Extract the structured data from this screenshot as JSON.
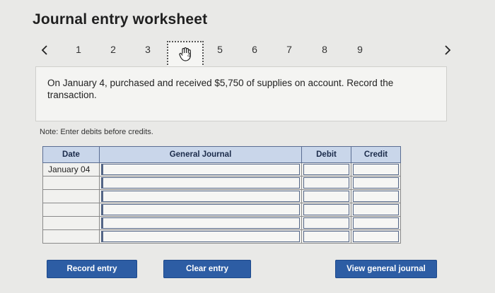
{
  "title": "Journal entry worksheet",
  "pager": {
    "prev_icon": "chevron-left",
    "next_icon": "chevron-right",
    "pages": [
      "1",
      "2",
      "3",
      "4",
      "5",
      "6",
      "7",
      "8",
      "9"
    ],
    "current_page": "4"
  },
  "question": "On January 4, purchased and received $5,750 of supplies on account. Record the transaction.",
  "note": "Note: Enter debits before credits.",
  "table": {
    "headers": {
      "date": "Date",
      "journal": "General Journal",
      "debit": "Debit",
      "credit": "Credit"
    },
    "rows": [
      {
        "date": "January 04",
        "account": "",
        "debit": "",
        "credit": ""
      },
      {
        "date": "",
        "account": "",
        "debit": "",
        "credit": ""
      },
      {
        "date": "",
        "account": "",
        "debit": "",
        "credit": ""
      },
      {
        "date": "",
        "account": "",
        "debit": "",
        "credit": ""
      },
      {
        "date": "",
        "account": "",
        "debit": "",
        "credit": ""
      },
      {
        "date": "",
        "account": "",
        "debit": "",
        "credit": ""
      }
    ]
  },
  "buttons": {
    "record": "Record entry",
    "clear": "Clear entry",
    "view": "View general journal"
  },
  "colors": {
    "background": "#e9e9e7",
    "header_fill": "#c9d6ea",
    "button": "#2d5da4"
  }
}
